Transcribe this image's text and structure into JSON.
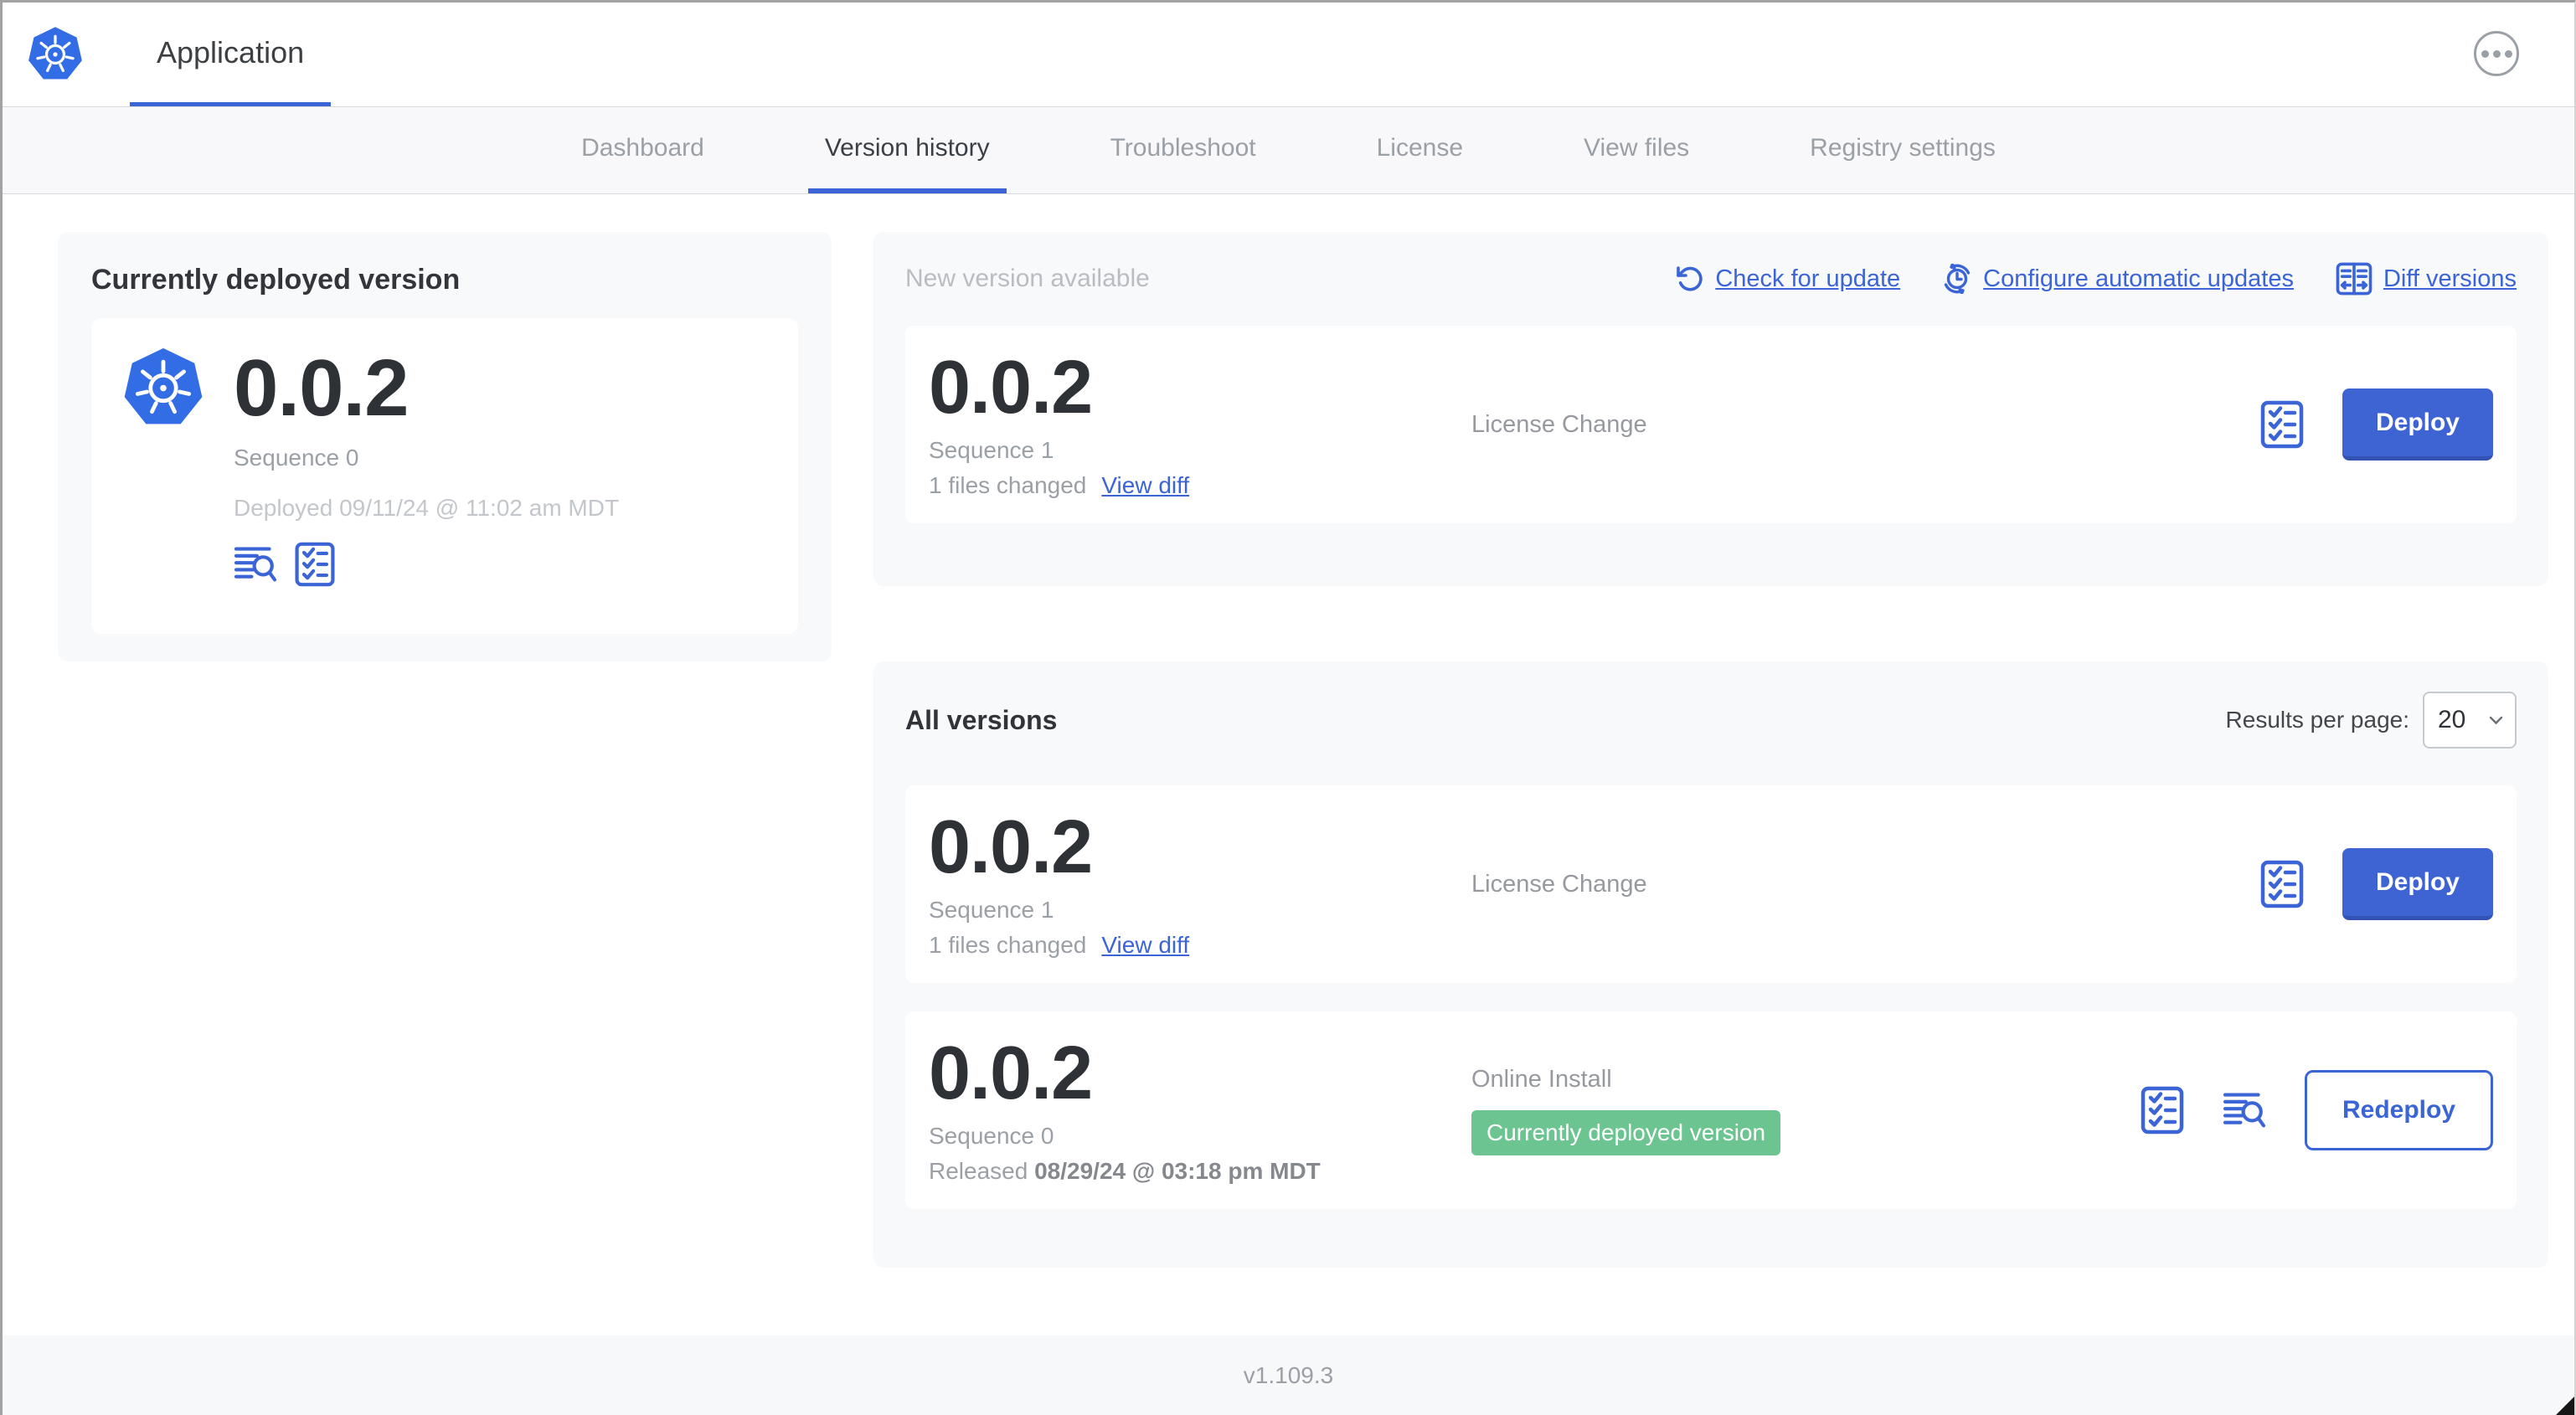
{
  "header": {
    "app_tab": "Application"
  },
  "nav": {
    "active_tab": "Version history",
    "tabs": [
      {
        "label": "Dashboard"
      },
      {
        "label": "Version history"
      },
      {
        "label": "Troubleshoot"
      },
      {
        "label": "License"
      },
      {
        "label": "View files"
      },
      {
        "label": "Registry settings"
      }
    ]
  },
  "currently_deployed": {
    "title": "Currently deployed version",
    "version": "0.0.2",
    "sequence": "Sequence 0",
    "deployed": "Deployed 09/11/24 @ 11:02 am MDT"
  },
  "new_version": {
    "title": "New version available",
    "actions": [
      {
        "label": "Check for update",
        "icon": "refresh-icon"
      },
      {
        "label": "Configure automatic updates",
        "icon": "auto-update-icon"
      },
      {
        "label": "Diff versions",
        "icon": "diff-icon"
      }
    ],
    "row": {
      "version": "0.0.2",
      "sequence": "Sequence 1",
      "files_changed": "1 files changed",
      "view_diff": "View diff",
      "source": "License Change",
      "action": "Deploy"
    }
  },
  "all_versions": {
    "title": "All versions",
    "results_per_page_label": "Results per page:",
    "results_per_page": "20",
    "rows": [
      {
        "version": "0.0.2",
        "sequence": "Sequence 1",
        "files_changed": "1 files changed",
        "view_diff": "View diff",
        "source": "License Change",
        "action": "Deploy"
      },
      {
        "version": "0.0.2",
        "sequence": "Sequence 0",
        "released_prefix": "Released",
        "released_date": "08/29/24 @ 03:18 pm MDT",
        "source": "Online Install",
        "badge": "Currently deployed version",
        "action": "Redeploy"
      }
    ]
  },
  "footer": {
    "version": "v1.109.3"
  },
  "colors": {
    "accent_blue": "#3b64d6",
    "kubernetes_blue": "#326de6",
    "badge_green": "#6cc591",
    "inactive_gray": "#9ba0a6",
    "panel_gray": "#f8f9fb"
  }
}
